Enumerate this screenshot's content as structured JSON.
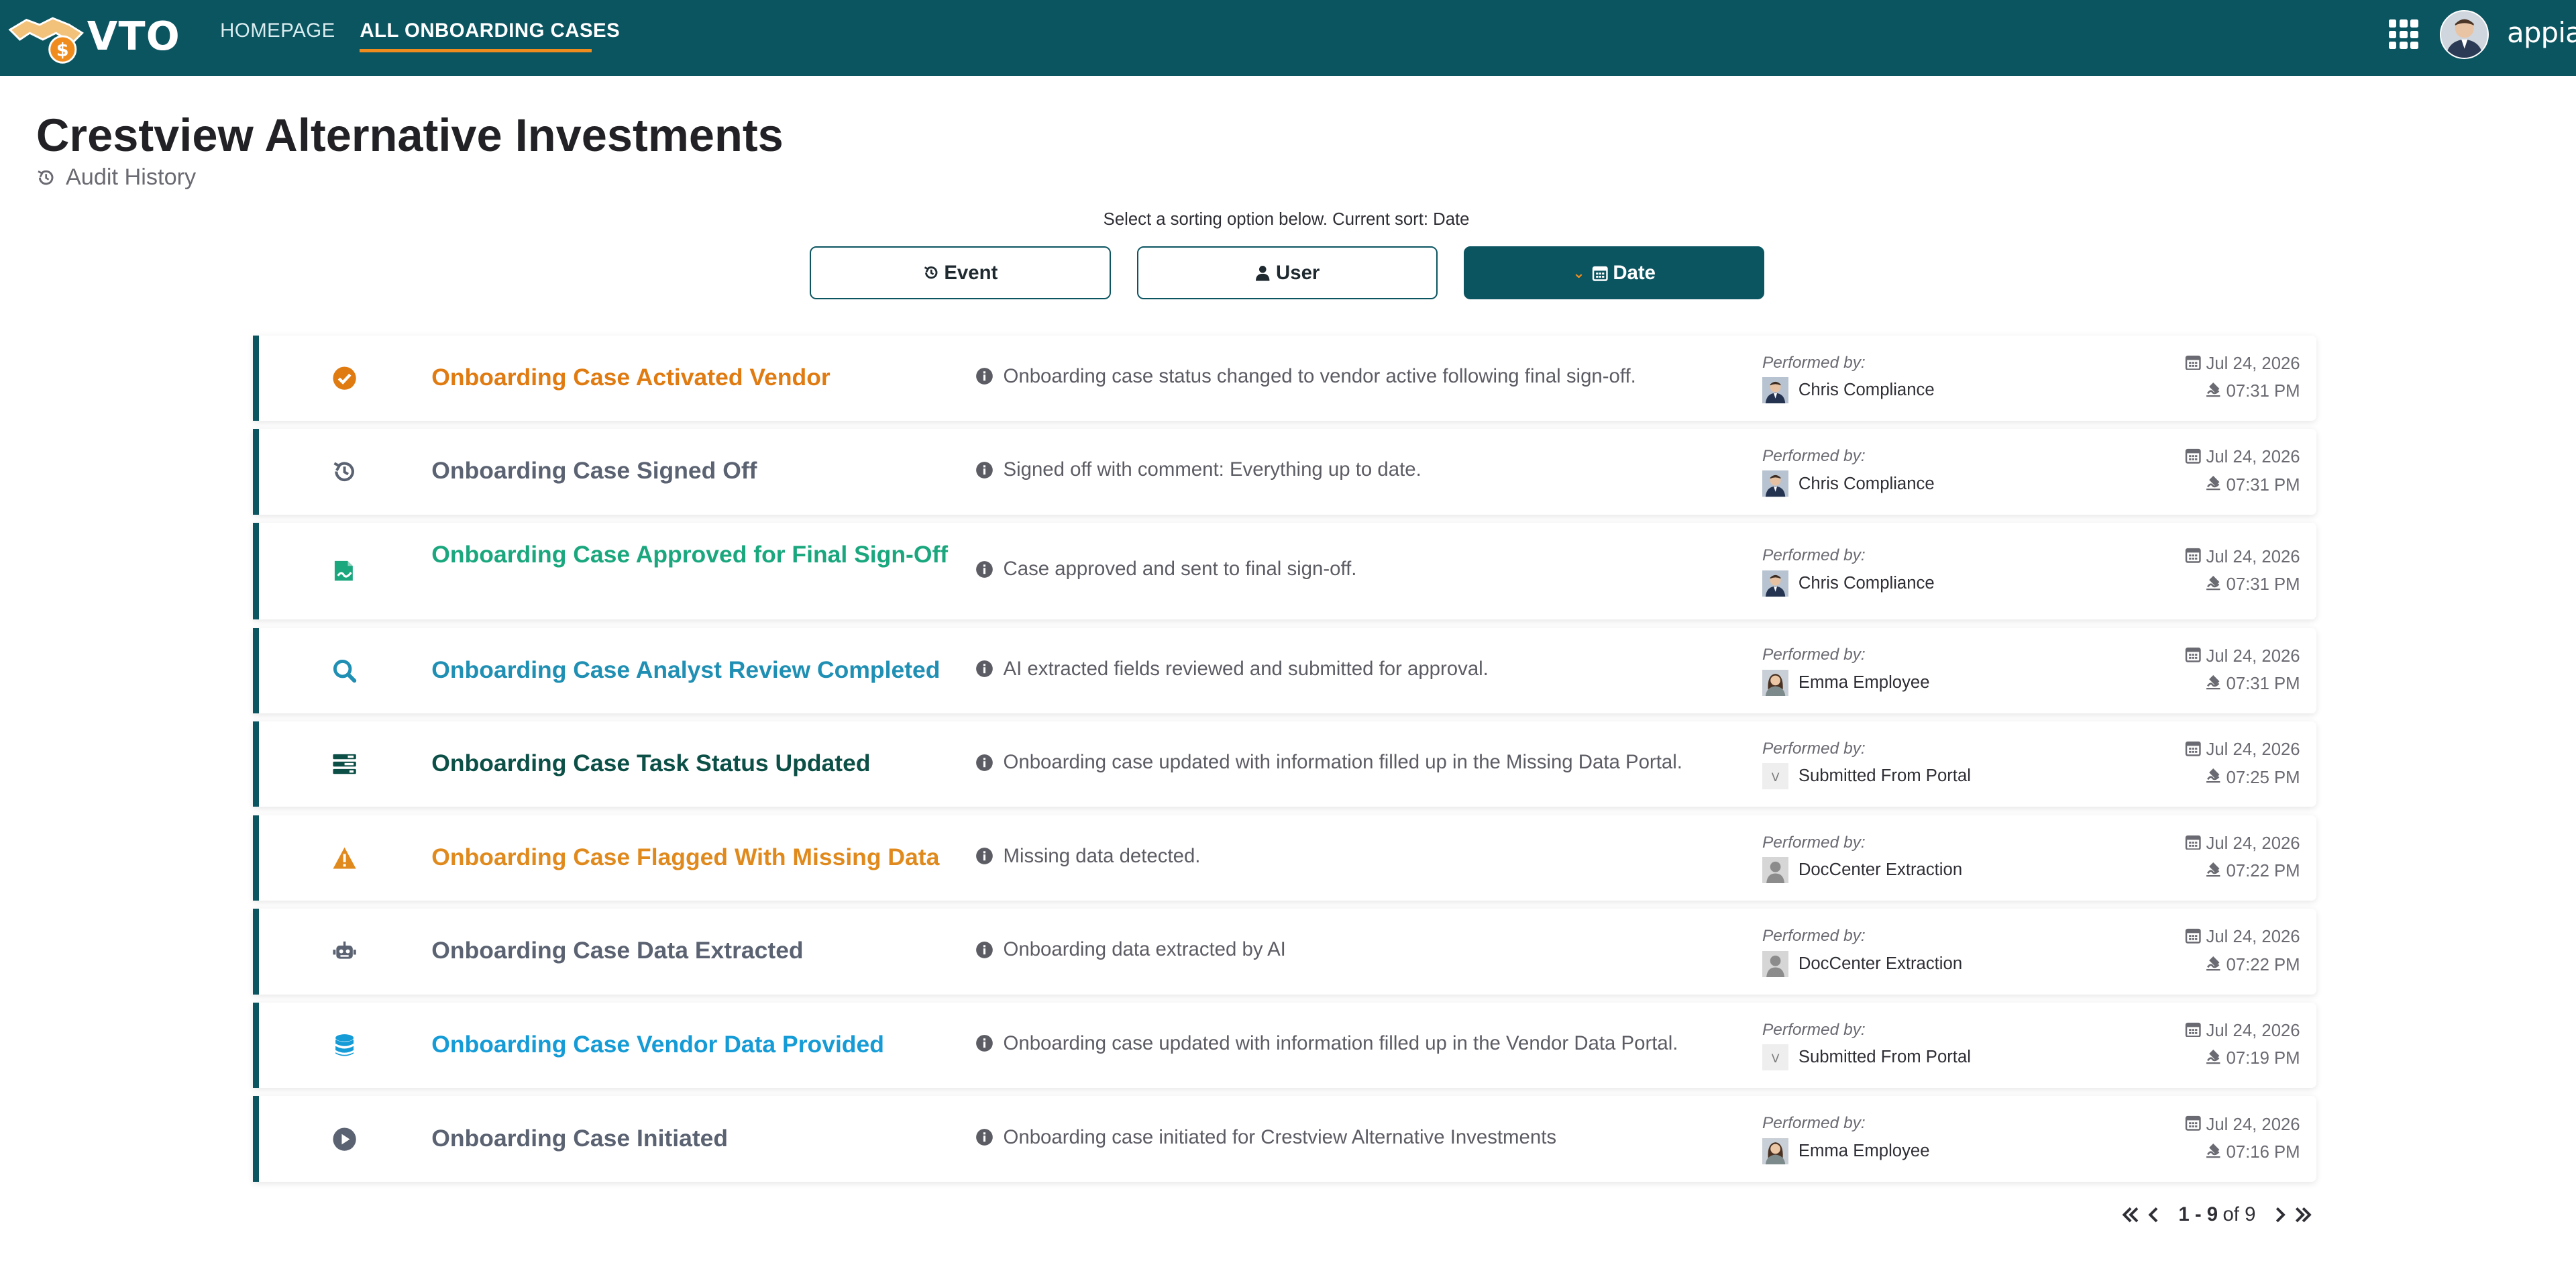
{
  "app": {
    "logo_text": "VTO",
    "nav": {
      "home": "HOMEPAGE",
      "cases": "ALL ONBOARDING CASES"
    },
    "brand": "appian",
    "accent_color": "#f08c1e",
    "primary_color": "#0b5561"
  },
  "header": {
    "title": "Crestview Alternative Investments",
    "subtitle": "Audit History"
  },
  "sort": {
    "prompt": "Select a sorting option below. Current sort: Date",
    "event_label": "Event",
    "user_label": "User",
    "date_label": "Date",
    "current": "Date"
  },
  "events": [
    {
      "title": "Onboarding Case Activated Vendor",
      "title_color": "#e07b12",
      "icon": "check-circle-icon",
      "description": "Onboarding case status changed to vendor active following final sign-off.",
      "performed_label": "Performed by:",
      "performer": "Chris Compliance",
      "performer_avatar": "photo",
      "date": "Jul 24, 2026",
      "time": "07:31 PM"
    },
    {
      "title": "Onboarding Case Signed Off",
      "title_color": "#5b6372",
      "icon": "history-icon",
      "description": "Signed off with comment: Everything up to date.",
      "performed_label": "Performed by:",
      "performer": "Chris Compliance",
      "performer_avatar": "photo",
      "date": "Jul 24, 2026",
      "time": "07:31 PM"
    },
    {
      "title": "Onboarding Case Approved for Final Sign-Off",
      "title_color": "#1aa77e",
      "icon": "sign-document-icon",
      "description": "Case approved and sent to final sign-off.",
      "performed_label": "Performed by:",
      "performer": "Chris Compliance",
      "performer_avatar": "photo",
      "date": "Jul 24, 2026",
      "time": "07:31 PM"
    },
    {
      "title": "Onboarding Case Analyst Review Completed",
      "title_color": "#1f8fb3",
      "icon": "search-icon",
      "description": "AI extracted fields reviewed and submitted for approval.",
      "performed_label": "Performed by:",
      "performer": "Emma Employee",
      "performer_avatar": "photo-female",
      "date": "Jul 24, 2026",
      "time": "07:31 PM"
    },
    {
      "title": "Onboarding Case Task Status Updated",
      "title_color": "#0b4f46",
      "icon": "task-list-icon",
      "description": "Onboarding case updated with information filled up in the Missing Data Portal.",
      "performed_label": "Performed by:",
      "performer": "Submitted From Portal",
      "performer_avatar": "letter",
      "performer_avatar_letter": "V",
      "date": "Jul 24, 2026",
      "time": "07:25 PM"
    },
    {
      "title": "Onboarding Case Flagged With Missing Data",
      "title_color": "#e08a1e",
      "icon": "warning-icon",
      "description": "Missing data detected.",
      "performed_label": "Performed by:",
      "performer": "DocCenter Extraction",
      "performer_avatar": "generic",
      "date": "Jul 24, 2026",
      "time": "07:22 PM"
    },
    {
      "title": "Onboarding Case Data Extracted",
      "title_color": "#5b6372",
      "icon": "robot-icon",
      "description": "Onboarding data extracted by AI",
      "performed_label": "Performed by:",
      "performer": "DocCenter Extraction",
      "performer_avatar": "generic",
      "date": "Jul 24, 2026",
      "time": "07:22 PM"
    },
    {
      "title": "Onboarding Case Vendor Data Provided",
      "title_color": "#159bd6",
      "icon": "database-icon",
      "description": "Onboarding case updated with information filled up in the Vendor Data Portal.",
      "performed_label": "Performed by:",
      "performer": "Submitted From Portal",
      "performer_avatar": "letter",
      "performer_avatar_letter": "V",
      "date": "Jul 24, 2026",
      "time": "07:19 PM"
    },
    {
      "title": "Onboarding Case Initiated",
      "title_color": "#5b6372",
      "icon": "play-circle-icon",
      "description": "Onboarding case initiated for Crestview Alternative Investments",
      "performed_label": "Performed by:",
      "performer": "Emma Employee",
      "performer_avatar": "photo-female",
      "date": "Jul 24, 2026",
      "time": "07:16 PM"
    }
  ],
  "pagination": {
    "range": "1 - 9",
    "of_label": "of 9"
  }
}
